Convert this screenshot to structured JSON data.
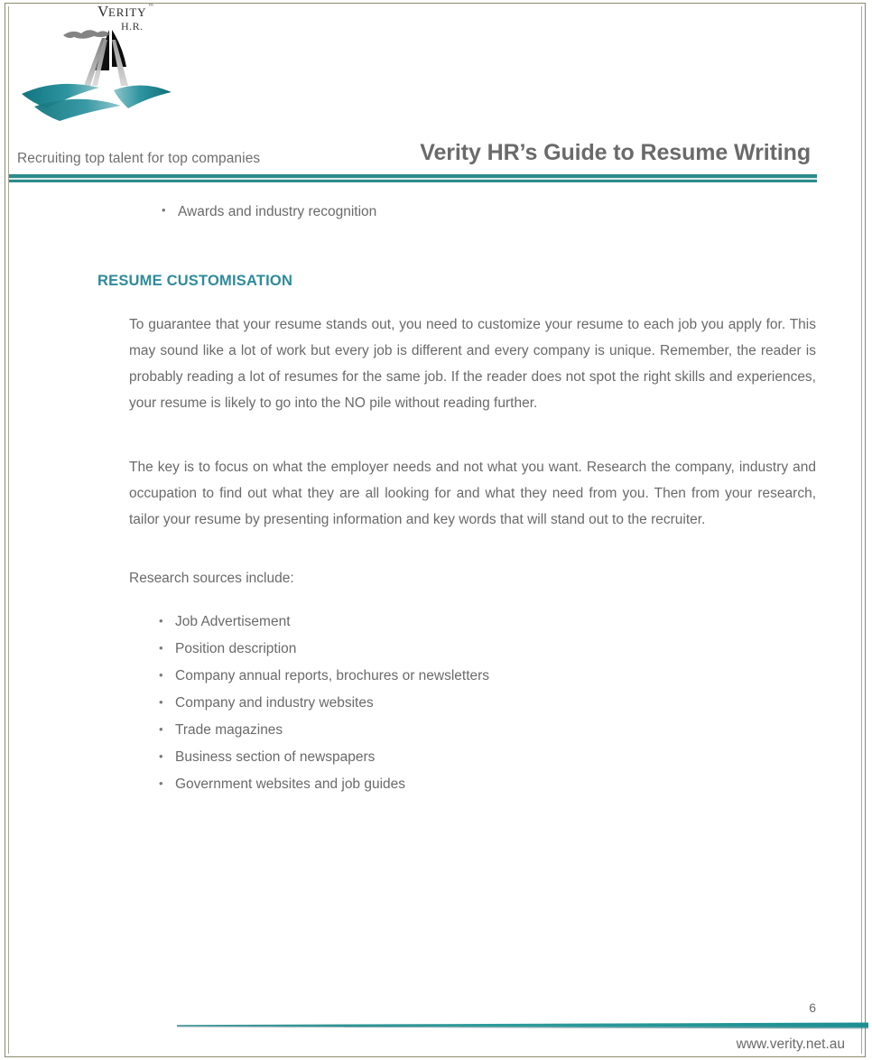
{
  "document": {
    "header": {
      "logo": {
        "brand_name": "VERITY",
        "brand_sub": "H.R.",
        "trademark": "™",
        "icon_name": "lighthouse-waves-logo"
      },
      "tagline": "Recruiting top talent for top companies",
      "title": "Verity HR’s Guide to Resume Writing",
      "rule_color": "#2e8b8b"
    },
    "body": {
      "lead_bullets": [
        "Awards and industry recognition"
      ],
      "section_heading": "RESUME CUSTOMISATION",
      "section_heading_color": "#2e8b9c",
      "paragraphs": [
        "To guarantee that your resume stands out, you need to customize your resume to each job you apply for. This may sound like a lot of work but every job is different and every company is unique. Remember, the reader is probably reading a lot of resumes for the same job. If the reader does not spot the right skills and experiences, your resume is likely to go into the NO pile without reading further.",
        "The key is to focus on what the employer needs and not what you want. Research the company, industry and occupation to find out what they are all looking for and what they need from you. Then from your research, tailor your resume by presenting information and key words that will stand out to the recruiter."
      ],
      "sources_intro": "Research sources include:",
      "sources": [
        "Job Advertisement",
        "Position description",
        "Company annual reports, brochures or newsletters",
        "Company and industry websites",
        "Trade magazines",
        "Business section of newspapers",
        "Government websites and job guides"
      ]
    },
    "footer": {
      "page_number": "6",
      "url": "www.verity.net.au",
      "rule_color": "#2e8b8b"
    }
  }
}
